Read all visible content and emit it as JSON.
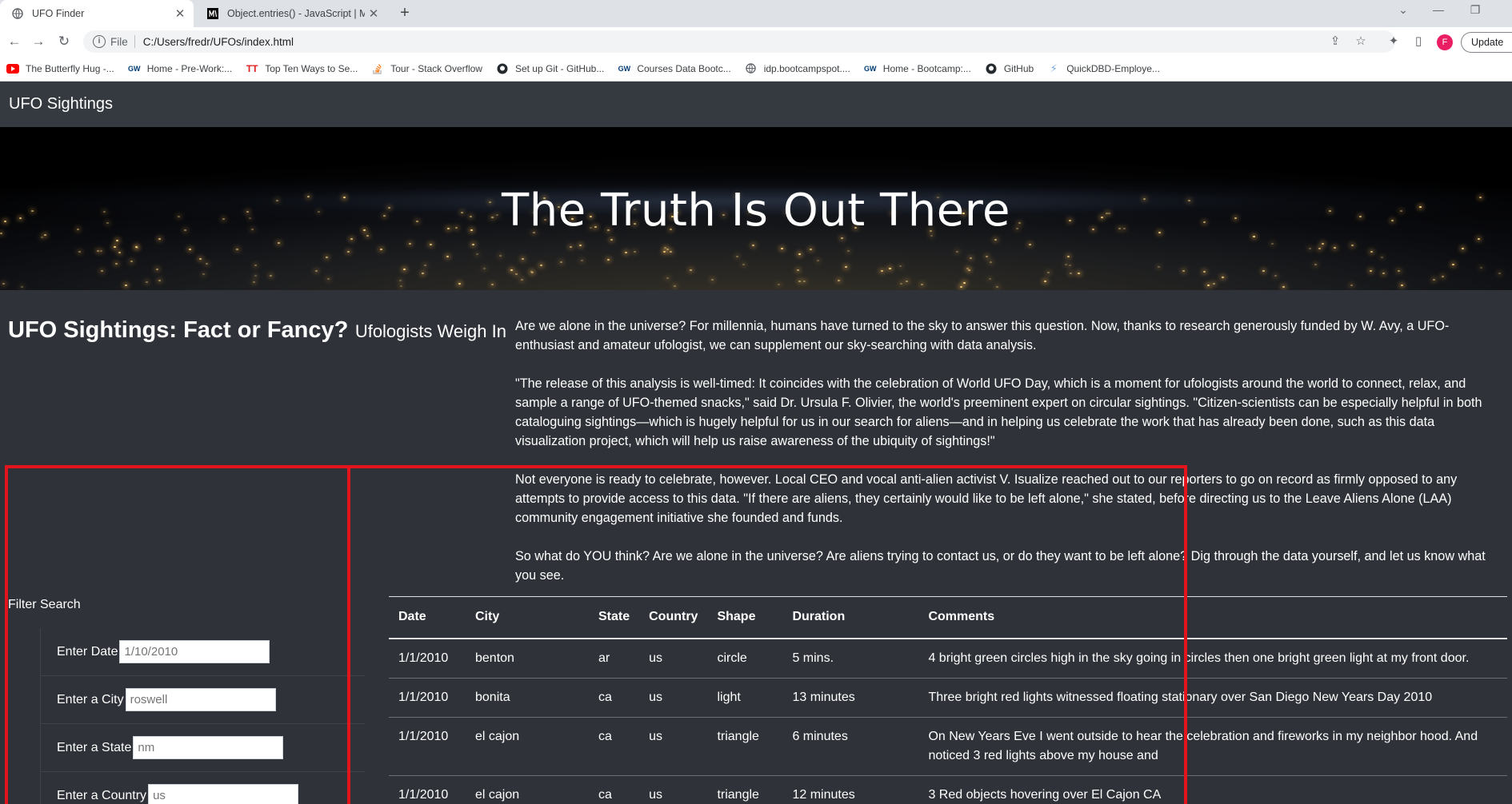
{
  "browser": {
    "tabs": [
      {
        "title": "UFO Finder",
        "active": true
      },
      {
        "title": "Object.entries() - JavaScript | MD",
        "active": false
      }
    ],
    "address": {
      "scheme": "File",
      "url": "C:/Users/fredr/UFOs/index.html"
    },
    "profile_initial": "F",
    "update_label": "Update",
    "bookmarks": [
      {
        "label": "The Butterfly Hug -...",
        "icon": "youtube-icon"
      },
      {
        "label": "Home - Pre-Work:...",
        "icon": "gw-icon"
      },
      {
        "label": "Top Ten Ways to Se...",
        "icon": "tt-icon"
      },
      {
        "label": "Tour - Stack Overflow",
        "icon": "stackoverflow-icon"
      },
      {
        "label": "Set up Git - GitHub...",
        "icon": "github-icon"
      },
      {
        "label": "Courses Data Bootc...",
        "icon": "gw-icon"
      },
      {
        "label": "idp.bootcampspot....",
        "icon": "globe-icon"
      },
      {
        "label": "Home - Bootcamp:...",
        "icon": "gw-icon"
      },
      {
        "label": "GitHub",
        "icon": "github-icon"
      },
      {
        "label": "QuickDBD-Employe...",
        "icon": "bolt-icon"
      }
    ]
  },
  "site": {
    "brand": "UFO Sightings",
    "hero_title": "The Truth Is Out There",
    "article_title": "UFO Sightings: Fact or Fancy?",
    "article_subtitle": "Ufologists Weigh In",
    "paragraphs": [
      "Are we alone in the universe? For millennia, humans have turned to the sky to answer this question. Now, thanks to research generously funded by W. Avy, a UFO-enthusiast and amateur ufologist, we can supplement our sky-searching with data analysis.",
      "\"The release of this analysis is well-timed: It coincides with the celebration of World UFO Day, which is a moment for ufologists around the world to connect, relax, and sample a range of UFO-themed snacks,\" said Dr. Ursula F. Olivier, the world's preeminent expert on circular sightings. \"Citizen-scientists can be especially helpful in both cataloguing sightings—which is hugely helpful for us in our search for aliens—and in helping us celebrate the work that has already been done, such as this data visualization project, which will help us raise awareness of the ubiquity of sightings!\"",
      "Not everyone is ready to celebrate, however. Local CEO and vocal anti-alien activist V. Isualize reached out to our reporters to go on record as firmly opposed to any attempts to provide access to this data. \"If there are aliens, they certainly would like to be left alone,\" she stated, before directing us to the Leave Aliens Alone (LAA) community engagement initiative she founded and funds.",
      "So what do YOU think? Are we alone in the universe? Are aliens trying to contact us, or do they want to be left alone? Dig through the data yourself, and let us know what you see."
    ],
    "filter": {
      "title": "Filter Search",
      "fields": [
        {
          "label": "Enter Date",
          "placeholder": "1/10/2010"
        },
        {
          "label": "Enter a City",
          "placeholder": "roswell"
        },
        {
          "label": "Enter a State",
          "placeholder": "nm"
        },
        {
          "label": "Enter a Country",
          "placeholder": "us"
        }
      ]
    },
    "table": {
      "headers": [
        "Date",
        "City",
        "State",
        "Country",
        "Shape",
        "Duration",
        "Comments"
      ],
      "rows": [
        [
          "1/1/2010",
          "benton",
          "ar",
          "us",
          "circle",
          "5 mins.",
          "4 bright green circles high in the sky going in circles then one bright green light at my front door."
        ],
        [
          "1/1/2010",
          "bonita",
          "ca",
          "us",
          "light",
          "13 minutes",
          "Three bright red lights witnessed floating stationary over San Diego New Years Day 2010"
        ],
        [
          "1/1/2010",
          "el cajon",
          "ca",
          "us",
          "triangle",
          "6 minutes",
          "On New Years Eve I went outside to hear the celebration and fireworks in my neighbor hood. And noticed 3 red lights above my house and"
        ],
        [
          "1/1/2010",
          "el cajon",
          "ca",
          "us",
          "triangle",
          "12 minutes",
          "3 Red objects hovering over El Cajon CA"
        ]
      ]
    }
  },
  "colors": {
    "page_bg": "#2f3238",
    "navbar_bg": "#343a40",
    "highlight_box": "#e3141b"
  }
}
